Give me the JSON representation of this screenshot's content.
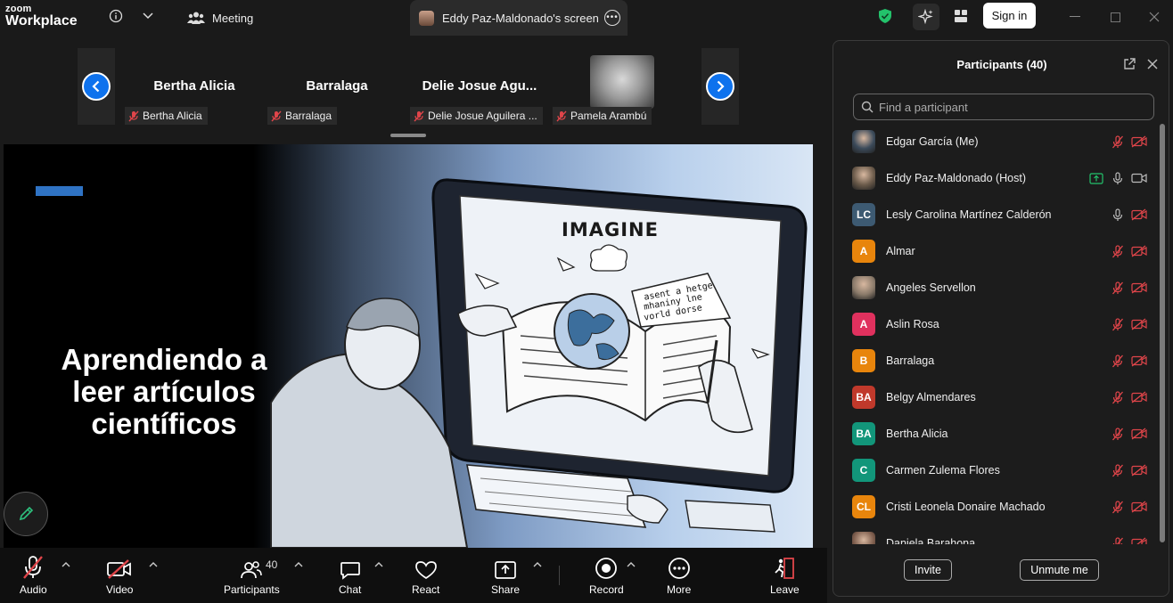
{
  "titlebar": {
    "logo_line1": "zoom",
    "logo_line2": "Workplace",
    "meeting_tab": "Meeting",
    "screen_tab": "Eddy Paz-Maldonado's screen",
    "signin_label": "Sign in"
  },
  "strip": {
    "tiles": [
      {
        "name": "Bertha Alicia",
        "label": "Bertha Alicia"
      },
      {
        "name": "Barralaga",
        "label": "Barralaga"
      },
      {
        "name": "Delie Josue Agu...",
        "label": "Delie Josue Aguilera ..."
      },
      {
        "name": "",
        "label": "Pamela Arambú"
      }
    ]
  },
  "slide": {
    "title": "Aprendiendo a leer artículos científicos",
    "screen_text_1": "IMAGINE",
    "screen_text_2": "asent a hetge",
    "screen_text_3": "mhaniny lne",
    "screen_text_4": "vorld dorse"
  },
  "toolbar": {
    "audio": "Audio",
    "video": "Video",
    "participants": "Participants",
    "participants_count": "40",
    "chat": "Chat",
    "react": "React",
    "share": "Share",
    "record": "Record",
    "more": "More",
    "leave": "Leave"
  },
  "panel": {
    "title": "Participants (40)",
    "search_placeholder": "Find a participant",
    "invite": "Invite",
    "unmute_me": "Unmute me",
    "participants": [
      {
        "name": "Edgar García (Me)",
        "avatar_type": "photo",
        "initials": "",
        "color": "#3b4a5a",
        "mic": "muted",
        "video": "off",
        "sharing": false
      },
      {
        "name": "Eddy Paz-Maldonado (Host)",
        "avatar_type": "photo",
        "initials": "",
        "color": "#6a5a4a",
        "mic": "on",
        "video": "on",
        "sharing": true
      },
      {
        "name": "Lesly Carolina Martínez Calderón",
        "avatar_type": "initials",
        "initials": "LC",
        "color": "#3d5a72",
        "mic": "on",
        "video": "off",
        "sharing": false
      },
      {
        "name": "Almar",
        "avatar_type": "initials",
        "initials": "A",
        "color": "#e8850c",
        "mic": "muted",
        "video": "off",
        "sharing": false
      },
      {
        "name": "Angeles Servellon",
        "avatar_type": "photo",
        "initials": "",
        "color": "#8a7a6a",
        "mic": "muted",
        "video": "off",
        "sharing": false
      },
      {
        "name": "Aslin Rosa",
        "avatar_type": "initials",
        "initials": "A",
        "color": "#e0315e",
        "mic": "muted",
        "video": "off",
        "sharing": false
      },
      {
        "name": "Barralaga",
        "avatar_type": "initials",
        "initials": "B",
        "color": "#e8850c",
        "mic": "muted",
        "video": "off",
        "sharing": false
      },
      {
        "name": "Belgy Almendares",
        "avatar_type": "initials",
        "initials": "BA",
        "color": "#c0392b",
        "mic": "muted",
        "video": "off",
        "sharing": false
      },
      {
        "name": "Bertha Alicia",
        "avatar_type": "initials",
        "initials": "BA",
        "color": "#12967a",
        "mic": "muted",
        "video": "off",
        "sharing": false
      },
      {
        "name": "Carmen Zulema Flores",
        "avatar_type": "initials",
        "initials": "C",
        "color": "#12967a",
        "mic": "muted",
        "video": "off",
        "sharing": false
      },
      {
        "name": "Cristi Leonela Donaire Machado",
        "avatar_type": "initials",
        "initials": "CL",
        "color": "#e8850c",
        "mic": "muted",
        "video": "off",
        "sharing": false
      },
      {
        "name": "Daniela Barahona",
        "avatar_type": "photo",
        "initials": "",
        "color": "#7a5a4a",
        "mic": "muted",
        "video": "off",
        "sharing": false
      }
    ]
  },
  "colors": {
    "accent": "#0e72ed",
    "muted_red": "#e0454a",
    "share_green": "#23c26b",
    "shield_green": "#23c26b"
  }
}
